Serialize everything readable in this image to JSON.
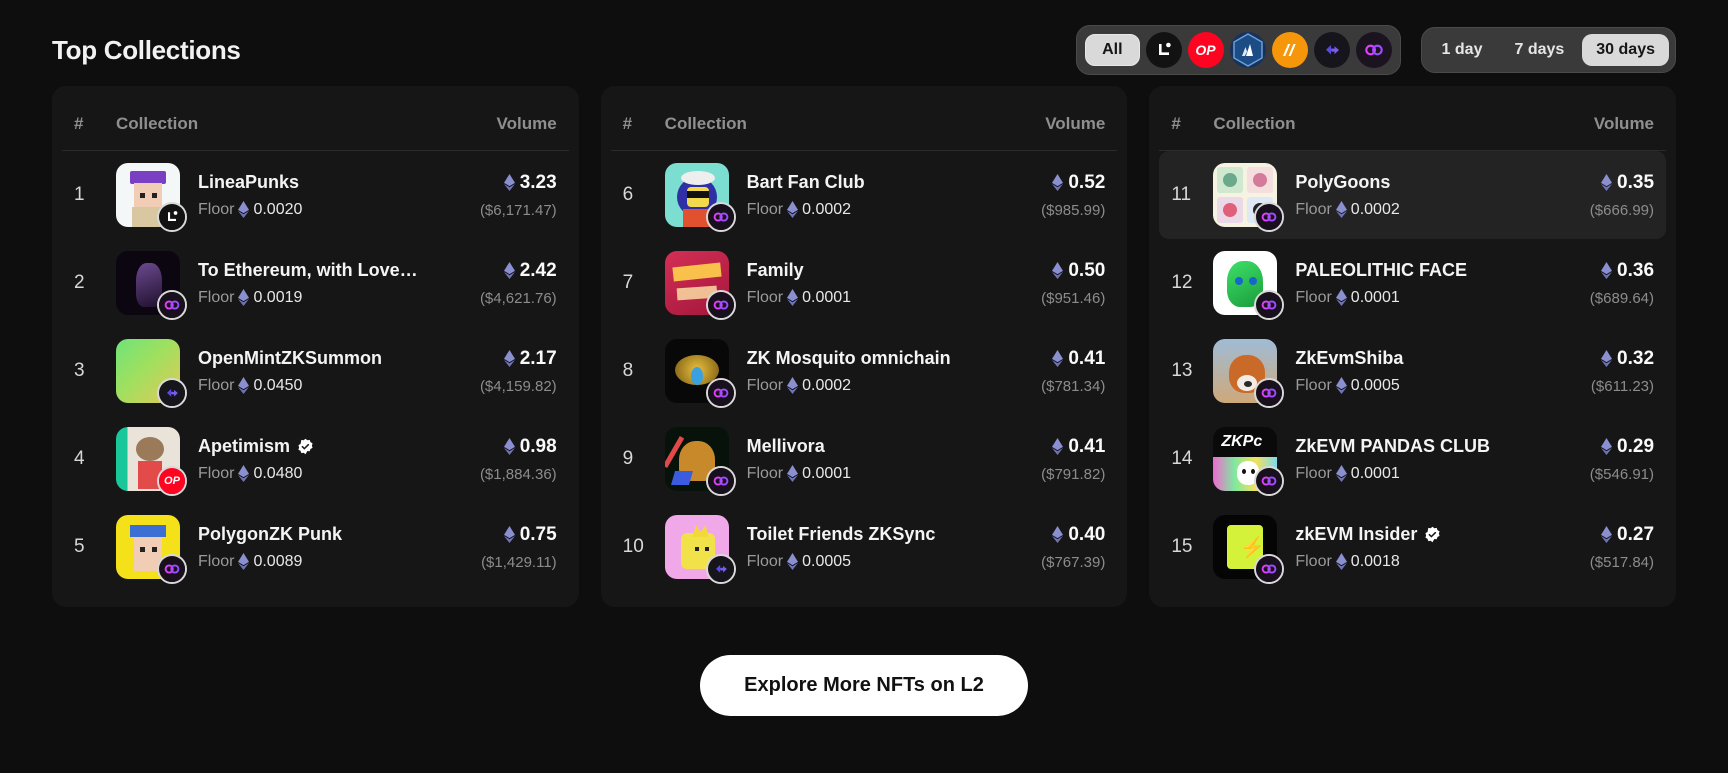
{
  "header": {
    "title": "Top Collections",
    "chain_filter": {
      "all_label": "All",
      "chains": [
        {
          "name": "linea",
          "label": "Linea"
        },
        {
          "name": "optimism",
          "label": "OP"
        },
        {
          "name": "arbitrum",
          "label": "Arbitrum"
        },
        {
          "name": "nahmii",
          "label": "N"
        },
        {
          "name": "scroll",
          "label": "Scroll"
        },
        {
          "name": "polygon-zkevm",
          "label": "Polygon zkEVM"
        }
      ]
    },
    "time_filter": {
      "options": [
        "1 day",
        "7 days",
        "30 days"
      ],
      "selected": "30 days"
    }
  },
  "table": {
    "headers": {
      "rank": "#",
      "collection": "Collection",
      "volume": "Volume"
    },
    "floor_label": "Floor"
  },
  "columns": [
    {
      "rows": [
        {
          "rank": "1",
          "name": "LineaPunks",
          "verified": false,
          "floor": "0.0020",
          "volume": "3.23",
          "usd": "($6,171.47)",
          "chain": "linea",
          "hovered": false
        },
        {
          "rank": "2",
          "name": "To Ethereum, with Love…",
          "verified": false,
          "floor": "0.0019",
          "volume": "2.42",
          "usd": "($4,621.76)",
          "chain": "polygon-zkevm",
          "hovered": false
        },
        {
          "rank": "3",
          "name": "OpenMintZKSummon",
          "verified": false,
          "floor": "0.0450",
          "volume": "2.17",
          "usd": "($4,159.82)",
          "chain": "scroll",
          "hovered": false
        },
        {
          "rank": "4",
          "name": "Apetimism",
          "verified": true,
          "floor": "0.0480",
          "volume": "0.98",
          "usd": "($1,884.36)",
          "chain": "optimism",
          "hovered": false
        },
        {
          "rank": "5",
          "name": "PolygonZK Punk",
          "verified": false,
          "floor": "0.0089",
          "volume": "0.75",
          "usd": "($1,429.11)",
          "chain": "polygon-zkevm",
          "hovered": false
        }
      ]
    },
    {
      "rows": [
        {
          "rank": "6",
          "name": "Bart Fan Club",
          "verified": false,
          "floor": "0.0002",
          "volume": "0.52",
          "usd": "($985.99)",
          "chain": "polygon-zkevm",
          "hovered": false
        },
        {
          "rank": "7",
          "name": "Family",
          "verified": false,
          "floor": "0.0001",
          "volume": "0.50",
          "usd": "($951.46)",
          "chain": "polygon-zkevm",
          "hovered": false
        },
        {
          "rank": "8",
          "name": "ZK Mosquito omnichain",
          "verified": false,
          "floor": "0.0002",
          "volume": "0.41",
          "usd": "($781.34)",
          "chain": "polygon-zkevm",
          "hovered": false
        },
        {
          "rank": "9",
          "name": "Mellivora",
          "verified": false,
          "floor": "0.0001",
          "volume": "0.41",
          "usd": "($791.82)",
          "chain": "polygon-zkevm",
          "hovered": false
        },
        {
          "rank": "10",
          "name": "Toilet Friends ZKSync",
          "verified": false,
          "floor": "0.0005",
          "volume": "0.40",
          "usd": "($767.39)",
          "chain": "scroll",
          "hovered": false
        }
      ]
    },
    {
      "rows": [
        {
          "rank": "11",
          "name": "PolyGoons",
          "verified": false,
          "floor": "0.0002",
          "volume": "0.35",
          "usd": "($666.99)",
          "chain": "polygon-zkevm",
          "hovered": true
        },
        {
          "rank": "12",
          "name": "PALEOLITHIC FACE",
          "verified": false,
          "floor": "0.0001",
          "volume": "0.36",
          "usd": "($689.64)",
          "chain": "polygon-zkevm",
          "hovered": false
        },
        {
          "rank": "13",
          "name": "ZkEvmShiba",
          "verified": false,
          "floor": "0.0005",
          "volume": "0.32",
          "usd": "($611.23)",
          "chain": "polygon-zkevm",
          "hovered": false
        },
        {
          "rank": "14",
          "name": "ZkEVM PANDAS CLUB",
          "verified": false,
          "floor": "0.0001",
          "volume": "0.29",
          "usd": "($546.91)",
          "chain": "polygon-zkevm",
          "hovered": false
        },
        {
          "rank": "15",
          "name": "zkEVM Insider",
          "verified": true,
          "floor": "0.0018",
          "volume": "0.27",
          "usd": "($517.84)",
          "chain": "polygon-zkevm",
          "hovered": false
        }
      ]
    }
  ],
  "footer": {
    "explore_label": "Explore More NFTs on L2"
  },
  "colors": {
    "background": "#0e0e0e",
    "card": "#161616",
    "accent_optimism": "#ff0420",
    "accent_polygon": "#a020f0",
    "muted_text": "#8f8f8f"
  }
}
